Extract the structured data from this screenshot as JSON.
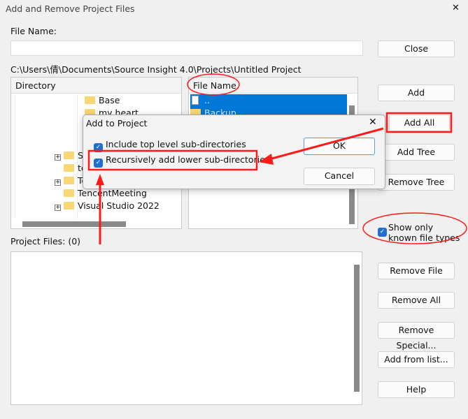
{
  "window": {
    "title": "Add and Remove Project Files",
    "close": "✕"
  },
  "file_name": {
    "label": "File Name:",
    "value": ""
  },
  "path": "C:\\Users\\倩\\Documents\\Source Insight 4.0\\Projects\\Untitled Project",
  "directory": {
    "header": "Directory",
    "items": [
      {
        "label": "Base"
      },
      {
        "label": "my heart"
      },
      {
        "label": "SY"
      },
      {
        "label": "te"
      },
      {
        "label": "Te"
      },
      {
        "label": "TencentMeeting"
      },
      {
        "label": "Visual Studio 2022"
      }
    ]
  },
  "files": {
    "header": "File Name",
    "items": [
      {
        "label": ".."
      },
      {
        "label": "Backup"
      }
    ]
  },
  "buttons": {
    "close": "Close",
    "add": "Add",
    "add_all": "Add All",
    "add_tree": "Add Tree",
    "remove_tree": "Remove Tree",
    "remove_file": "Remove File",
    "remove_all": "Remove All",
    "remove_special": "Remove Special...",
    "add_from_list": "Add from list...",
    "help": "Help"
  },
  "show_known": {
    "label": "Show only known file types",
    "checked": true
  },
  "project_files": {
    "label": "Project Files: (0)"
  },
  "dialog": {
    "title": "Add to Project",
    "close": "✕",
    "include_top": {
      "label": "Include top level sub-directories",
      "checked": true
    },
    "recursive": {
      "label": "Recursively add lower sub-directories",
      "checked": true
    },
    "ok": "OK",
    "cancel": "Cancel"
  },
  "colors": {
    "annotation": "#ff1a1a",
    "selection": "#0078d7",
    "checkbox": "#1f6fcf"
  }
}
